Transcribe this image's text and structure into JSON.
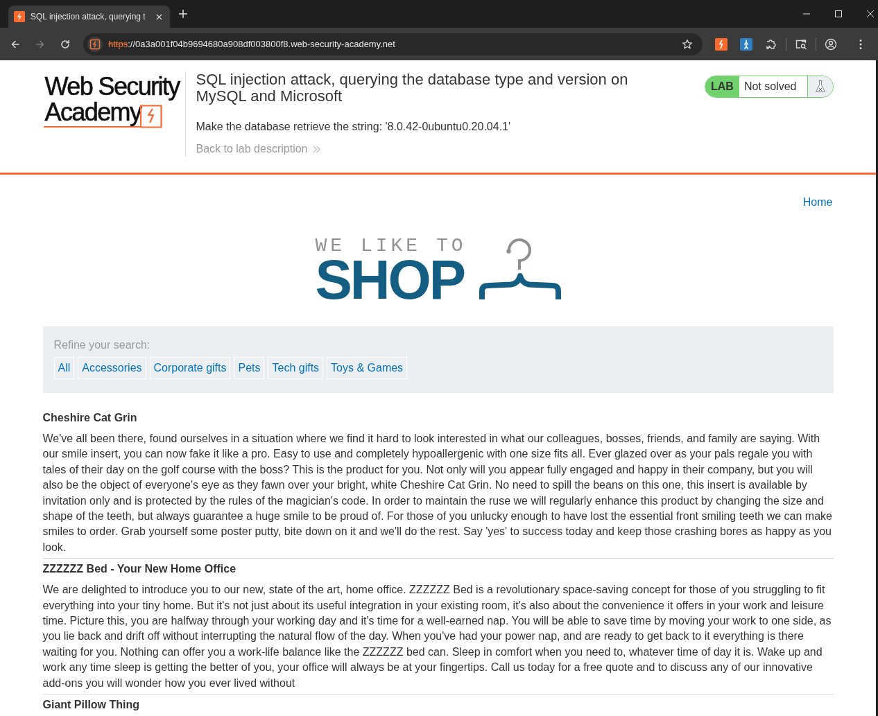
{
  "browser": {
    "tab": {
      "title": "SQL injection attack, querying t"
    },
    "nav_buttons": [
      {
        "kind": "back",
        "disabled": false
      },
      {
        "kind": "forward",
        "disabled": true
      },
      {
        "kind": "reload",
        "disabled": false
      }
    ],
    "url": {
      "scheme": "https",
      "rest": "://0a3a001f04b9694680a908df003800f8.web-security-academy.net",
      "not_secure": true
    }
  },
  "header": {
    "logo": {
      "line1": "Web Security",
      "line2": "Academy"
    },
    "title": "SQL injection attack, querying the database type and version on MySQL and Microsoft",
    "description": "Make the database retrieve the string: '8.0.42-0ubuntu0.20.04.1'",
    "back_link": "Back to lab description",
    "lab_badge": {
      "label": "LAB",
      "status": "Not solved"
    }
  },
  "nav": {
    "home": "Home"
  },
  "shop_logo": {
    "tagline": "WE LIKE TO",
    "word": "SHOP"
  },
  "filters": {
    "label": "Refine your search:",
    "categories": [
      "All",
      "Accessories",
      "Corporate gifts",
      "Pets",
      "Tech gifts",
      "Toys & Games"
    ]
  },
  "products": [
    {
      "name": "Cheshire Cat Grin",
      "description": "We've all been there, found ourselves in a situation where we find it hard to look interested in what our colleagues, bosses, friends, and family are saying. With our smile insert, you can now fake it like a pro. Easy to use and completely hypoallergenic with one size fits all. Ever glazed over as your pals regale you with tales of their day on the golf course with the boss? This is the product for you. Not only will you appear fully engaged and happy in their company, but you will also be the object of everyone's eye as they fawn over your bright, white Cheshire Cat Grin. No need to spill the beans on this one, this insert is available by invitation only and is protected by the rules of the magician's code. In order to maintain the ruse we will regularly enhance this product by changing the size and shape of the teeth, but always guarantee a huge smile to be proud of. For those of you unlucky enough to have lost the essential front smiling teeth we can make smiles to order. Grab yourself some poster putty, bite down on it and we'll do the rest. Say 'yes' to success today and keep those crashing bores as happy as you look."
    },
    {
      "name": "ZZZZZZ Bed - Your New Home Office",
      "description": "We are delighted to introduce you to our new, state of the art, home office. ZZZZZZ Bed is a revolutionary space-saving concept for those of you struggling to fit everything into your tiny home. But it's not just about its useful integration in your existing room, it's also about the convenience it offers in your work and leisure time. Picture this, you are halfway through your working day and it's time for a well-earned nap. You will be able to save time by moving your work to one side, as you lie back and drift off without interrupting the natural flow of the day. When you've had your power nap, and are ready to get back to it everything is there waiting for you. Nothing can offer you a work-life balance like the ZZZZZZ bed can. Sleep in comfort when you need to, whatever time of day it is. Wake up and work any time sleep is getting the better of you, your office will always be at your fingertips. Call us today for a free quote and to discuss any of our innovative add-ons you will wonder how you ever lived without"
    },
    {
      "name": "Giant Pillow Thing"
    }
  ]
}
